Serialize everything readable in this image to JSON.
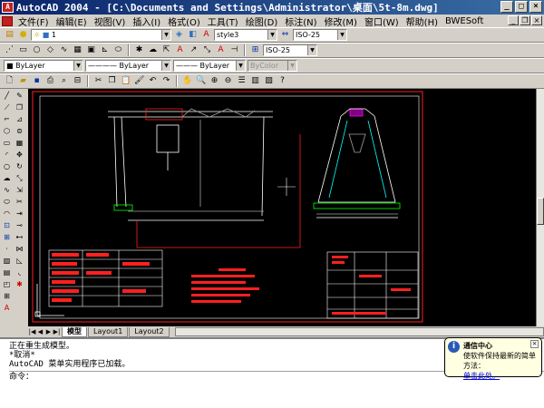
{
  "window": {
    "title": "AutoCAD 2004 - [C:\\Documents and Settings\\Administrator\\桌面\\5t-8m.dwg]"
  },
  "menu": [
    "文件(F)",
    "编辑(E)",
    "视图(V)",
    "插入(I)",
    "格式(O)",
    "工具(T)",
    "绘图(D)",
    "标注(N)",
    "修改(M)",
    "窗口(W)",
    "帮助(H)",
    "BWESoft"
  ],
  "toolbar": {
    "layer_value": "1",
    "text_style": "style3",
    "dim_style": "ISO-25",
    "table_style": "ISO-25",
    "color": "ByLayer",
    "linetype": "ByLayer",
    "lineweight": "ByLayer",
    "plotstyle": "ByColor"
  },
  "tabs": [
    "模型",
    "Layout1",
    "Layout2"
  ],
  "active_tab": "模型",
  "command": {
    "lines": [
      "正在重生成模型。",
      "*取消*",
      "AutoCAD 菜单实用程序已加载。"
    ],
    "prompt": "命令："
  },
  "balloon": {
    "title": "通信中心",
    "text": "使软件保持最新的简单方法：",
    "link": "单击此处。"
  },
  "colors": {
    "title_start": "#0a246a",
    "title_end": "#3a6ea5",
    "canvas": "#000000",
    "drawing_red": "#ff2020"
  }
}
